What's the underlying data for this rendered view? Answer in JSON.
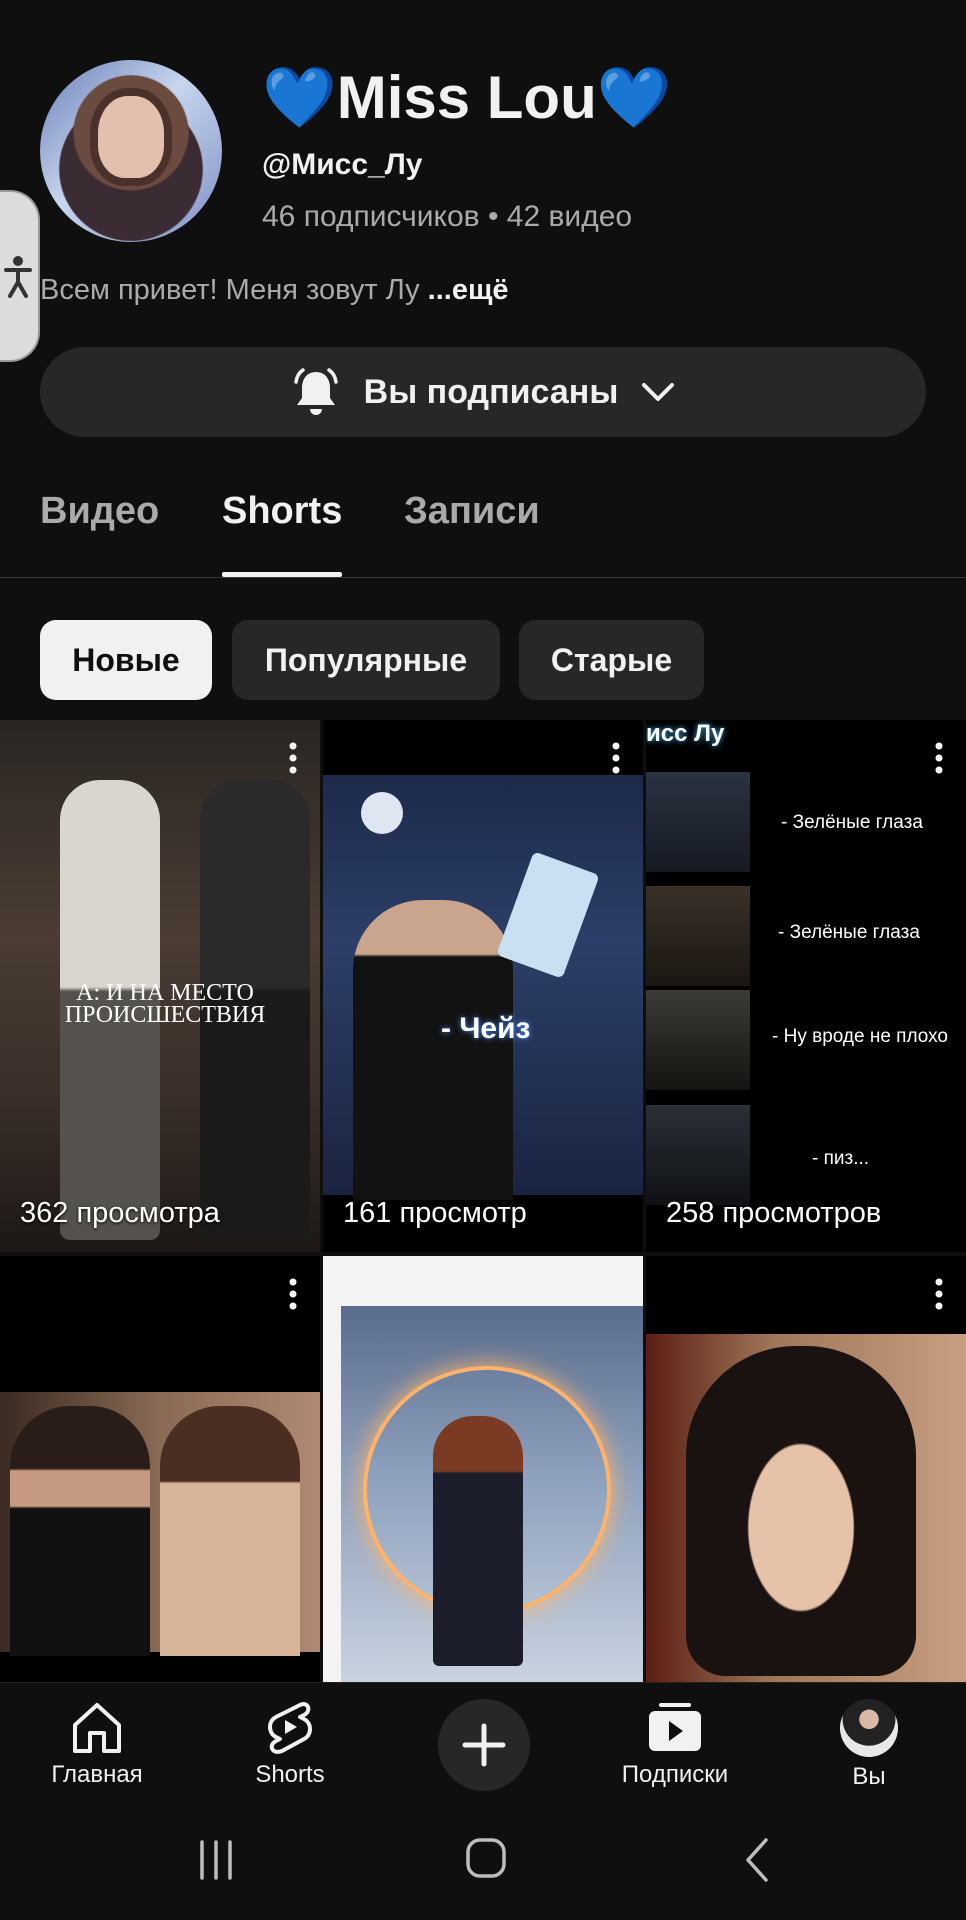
{
  "channel": {
    "heart_left": "💙",
    "name": "Miss Lou",
    "heart_right": "💙",
    "handle": "@Мисс_Лу",
    "stats": "46 подписчиков • 42 видео",
    "bio": "Всем привет! Меня зовут Лу ",
    "bio_more": "...ещё"
  },
  "subscribe": {
    "label": "Вы подписаны"
  },
  "tabs": [
    {
      "label": "Видео",
      "active": false
    },
    {
      "label": "Shorts",
      "active": true
    },
    {
      "label": "Записи",
      "active": false
    }
  ],
  "chips": [
    {
      "label": "Новые",
      "active": true
    },
    {
      "label": "Популярные",
      "active": false
    },
    {
      "label": "Старые",
      "active": false
    }
  ],
  "shorts": [
    {
      "views": "362 просмотра",
      "overlay": "А: И НА МЕСТО ПРОИСШЕСТВИЯ"
    },
    {
      "views": "161 просмотр",
      "overlay": "- Чейз"
    },
    {
      "views": "258 просмотров",
      "overlay_title": "исс Лу",
      "lines": [
        "- Зелёные глаза",
        "- Зелёные глаза",
        "- Ну вроде не плохо",
        "- пиз..."
      ]
    },
    {
      "views": ""
    },
    {
      "views": ""
    },
    {
      "views": ""
    }
  ],
  "bottom_nav": {
    "home": "Главная",
    "shorts": "Shorts",
    "subscriptions": "Подписки",
    "you": "Вы"
  },
  "colors": {
    "background": "#0f0f0f",
    "chip": "#272727",
    "accent_heart": "#4fd1f5"
  }
}
